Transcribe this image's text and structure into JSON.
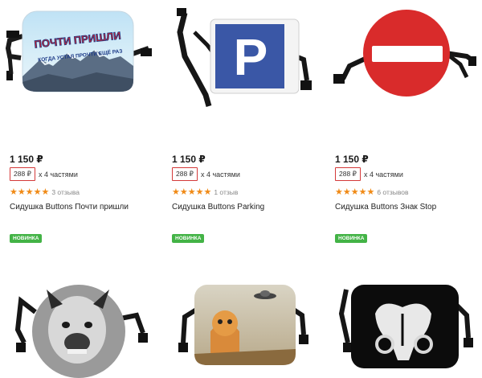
{
  "products": [
    {
      "price": "1 150 ₽",
      "installment_box": "288 ₽",
      "installment_text": "х 4 частями",
      "stars": "★★★★★",
      "reviews": "3 отзыва",
      "title": "Сидушка Buttons Почти пришли",
      "badge": "НОВИНКА",
      "image_text": "ПОЧТИ ПРИШЛИ",
      "image_subtext": "КОГДА УСТАЛ ПРОЧТИ ЕЩЁ РАЗ"
    },
    {
      "price": "1 150 ₽",
      "installment_box": "288 ₽",
      "installment_text": "х 4 частями",
      "stars": "★★★★★",
      "reviews": "1 отзыв",
      "title": "Сидушка Buttons Parking",
      "badge": "НОВИНКА",
      "image_text": "P"
    },
    {
      "price": "1 150 ₽",
      "installment_box": "288 ₽",
      "installment_text": "х 4 частями",
      "stars": "★★★★★",
      "reviews": "6 отзывов",
      "title": "Сидушка Buttons Знак Stop",
      "badge": "НОВИНКА"
    }
  ],
  "colors": {
    "accent_orange": "#f08a16",
    "badge_green": "#43b346",
    "installment_red": "#d43a3a",
    "stop_red": "#d92b2b",
    "parking_blue": "#3a57a6"
  },
  "icons": [
    "star-icon",
    "strap-buckle-icon"
  ]
}
